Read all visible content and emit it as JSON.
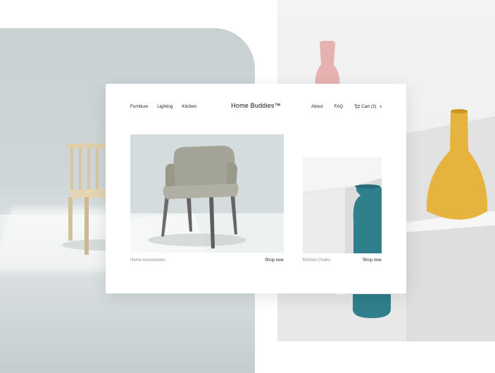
{
  "header": {
    "brand": "Home Buddies™",
    "nav_left": [
      "Furniture",
      "Lighting",
      "Kitchen"
    ],
    "nav_right": {
      "about": "About",
      "faq": "FAQ",
      "cart": "Cart (2)"
    }
  },
  "tiles": [
    {
      "caption": "Home Accessories",
      "action": "Shop now"
    },
    {
      "caption": "Kitchen Chairs",
      "action": "Shop now"
    }
  ],
  "icons": {
    "cart": "cart-icon",
    "cart_dropdown": "chevron-down-icon"
  },
  "colors": {
    "card_bg": "#ffffff",
    "left_backdrop": "#cfd6d8",
    "right_backdrop": "#efefef",
    "vase_pink": "#e5b2b0",
    "vase_mustard": "#e6b33e",
    "vase_teal": "#2f7f8c",
    "chair_wood": "#dcc9a6",
    "armchair_fabric": "#9e9d92"
  }
}
